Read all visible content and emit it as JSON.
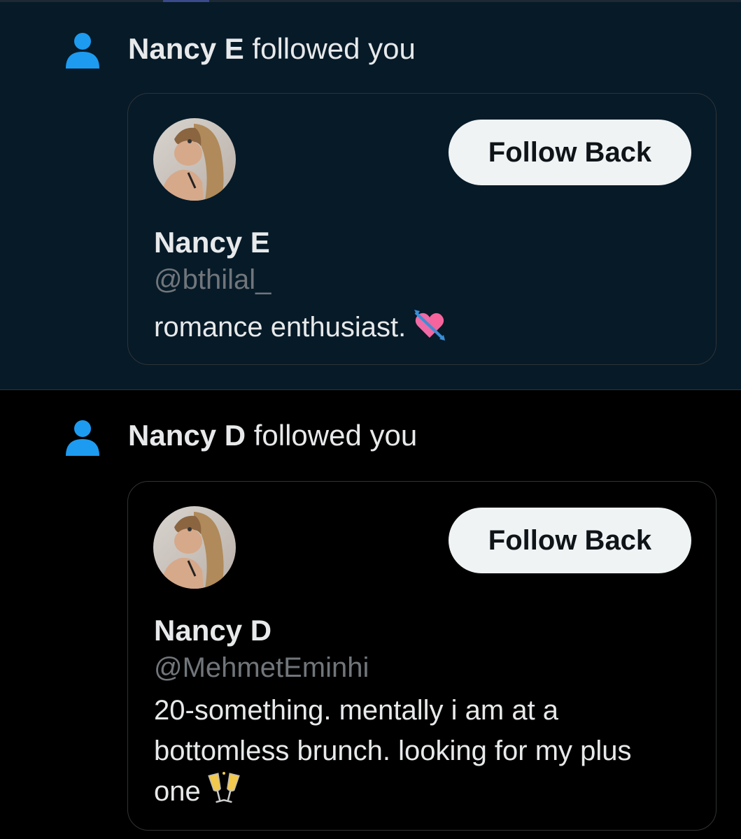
{
  "colors": {
    "unread_background": "#071a28",
    "background": "#000000",
    "accent_icon": "#1d9bf0",
    "text_primary": "#e7e9ea",
    "text_secondary": "#71767b",
    "button_background": "#eff3f4",
    "button_text": "#0f1419"
  },
  "notifications": [
    {
      "icon": "person-icon",
      "name": "Nancy E",
      "action_text": "followed you",
      "card": {
        "display_name": "Nancy E",
        "handle": "@bthilal_",
        "bio": "romance enthusiast.",
        "bio_emoji": "heart-with-arrow-emoji",
        "button_label": "Follow Back"
      }
    },
    {
      "icon": "person-icon",
      "name": "Nancy D",
      "action_text": "followed you",
      "card": {
        "display_name": "Nancy D",
        "handle": "@MehmetEminhi",
        "bio": "20-something. mentally i am at a bottomless brunch. looking for my plus one",
        "bio_emoji": "clinking-glasses-emoji",
        "button_label": "Follow Back"
      }
    }
  ]
}
